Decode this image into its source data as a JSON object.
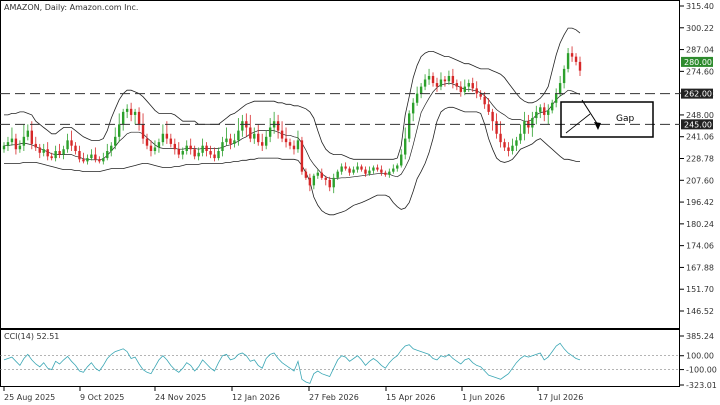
{
  "header": {
    "title": "AMAZON, Daily: Amazon.com Inc."
  },
  "cci": {
    "label": "CCI(14) 52.51"
  },
  "annotation": {
    "gap_label": "Gap"
  },
  "colors": {
    "up": "#2ca02c",
    "down": "#d62728",
    "cci": "#3ba7b5",
    "tag_green": "#2e8b2e",
    "tag_dark": "#222222"
  },
  "chart_data": {
    "type": "candlestick",
    "title": "AMAZON, Daily: Amazon.com Inc.",
    "price_axis": {
      "ticks": [
        "315.40",
        "300.22",
        "287.04",
        "274.60",
        "262.32",
        "248.00",
        "241.06",
        "228.78",
        "207.60",
        "196.42",
        "180.24",
        "174.06",
        "167.88",
        "151.70",
        "146.52"
      ],
      "tick_values": [
        315.4,
        300.22,
        287.04,
        274.6,
        262.32,
        248.0,
        241.06,
        228.78,
        207.6,
        196.42,
        180.24,
        174.06,
        167.88,
        151.7,
        146.52
      ]
    },
    "price_tags": [
      {
        "label": "280.00",
        "value": 280.0,
        "style": "green"
      },
      {
        "label": "262.00",
        "value": 262.0,
        "style": "dark"
      },
      {
        "label": "245.00",
        "value": 245.0,
        "style": "dark"
      }
    ],
    "horizontal_levels": [
      262.0,
      245.0
    ],
    "x_labels": [
      "25 Aug 2025",
      "9 Oct 2025",
      "24 Nov 2025",
      "12 Jan 2026",
      "27 Feb 2026",
      "15 Apr 2026",
      "1 Jun 2026",
      "17 Jul 2026"
    ],
    "close_series": [
      236,
      238,
      240,
      234,
      236,
      241,
      243,
      237,
      235,
      232,
      234,
      230,
      229,
      233,
      231,
      234,
      239,
      236,
      233,
      228,
      226,
      229,
      231,
      228,
      226,
      229,
      233,
      236,
      241,
      245,
      250,
      252,
      248,
      250,
      245,
      240,
      236,
      233,
      235,
      238,
      242,
      240,
      237,
      234,
      231,
      233,
      236,
      234,
      230,
      232,
      236,
      233,
      231,
      229,
      233,
      238,
      240,
      237,
      239,
      243,
      246,
      244,
      240,
      242,
      238,
      236,
      241,
      244,
      246,
      243,
      240,
      238,
      236,
      234,
      239,
      216,
      210,
      205,
      212,
      215,
      210,
      208,
      204,
      210,
      216,
      221,
      219,
      215,
      218,
      221,
      218,
      214,
      217,
      220,
      218,
      215,
      213,
      216,
      219,
      222,
      231,
      240,
      249,
      256,
      262,
      266,
      270,
      272,
      268,
      266,
      270,
      269,
      272,
      268,
      266,
      263,
      266,
      268,
      265,
      262,
      260,
      255,
      250,
      246,
      242,
      238,
      235,
      233,
      236,
      239,
      242,
      246,
      244,
      247,
      250,
      253,
      248,
      251,
      256,
      262,
      268,
      276,
      285,
      283,
      280,
      275
    ],
    "bb_upper": [
      248,
      248,
      249,
      249,
      250,
      250,
      249,
      248,
      246,
      245,
      244,
      243,
      242,
      242,
      243,
      244,
      244,
      244,
      243,
      242,
      241,
      240,
      239,
      239,
      239,
      240,
      243,
      247,
      252,
      258,
      262,
      264,
      264,
      263,
      262,
      260,
      257,
      254,
      251,
      249,
      249,
      249,
      249,
      248,
      247,
      246,
      246,
      246,
      246,
      245,
      245,
      245,
      245,
      245,
      245,
      246,
      247,
      248,
      249,
      251,
      253,
      255,
      256,
      257,
      257,
      257,
      257,
      257,
      257,
      256,
      256,
      255,
      255,
      254,
      254,
      253,
      252,
      250,
      247,
      243,
      238,
      234,
      232,
      231,
      231,
      231,
      230,
      229,
      228,
      228,
      228,
      228,
      228,
      228,
      228,
      228,
      228,
      228,
      228,
      229,
      236,
      248,
      260,
      271,
      278,
      283,
      285,
      286,
      286,
      285,
      284,
      283,
      283,
      282,
      281,
      280,
      279,
      279,
      278,
      277,
      276,
      276,
      276,
      275,
      274,
      273,
      271,
      268,
      265,
      262,
      259,
      257,
      256,
      256,
      257,
      259,
      262,
      266,
      275,
      284,
      291,
      296,
      300,
      300,
      299,
      297
    ],
    "bb_lower": [
      224,
      224,
      224,
      224,
      224,
      225,
      225,
      225,
      225,
      224,
      223,
      222,
      221,
      220,
      219,
      218,
      218,
      218,
      217,
      217,
      216,
      216,
      216,
      216,
      216,
      217,
      218,
      219,
      219,
      219,
      219,
      220,
      221,
      222,
      223,
      224,
      224,
      223,
      222,
      221,
      220,
      220,
      220,
      221,
      221,
      222,
      223,
      223,
      223,
      223,
      224,
      224,
      224,
      224,
      224,
      224,
      225,
      225,
      226,
      226,
      227,
      227,
      228,
      228,
      229,
      229,
      229,
      229,
      229,
      229,
      228,
      228,
      228,
      228,
      227,
      222,
      215,
      207,
      199,
      194,
      190,
      188,
      187,
      187,
      188,
      189,
      190,
      192,
      194,
      195,
      196,
      197,
      198,
      199,
      200,
      200,
      200,
      199,
      196,
      193,
      191,
      192,
      196,
      202,
      209,
      216,
      224,
      232,
      240,
      246,
      250,
      252,
      253,
      253,
      252,
      251,
      250,
      250,
      250,
      250,
      249,
      245,
      240,
      234,
      229,
      226,
      225,
      226,
      228,
      231,
      234,
      235,
      236,
      237,
      239,
      240,
      238,
      236,
      234,
      232,
      230,
      228,
      228,
      227,
      226,
      226
    ],
    "cci_axis": {
      "ticks": [
        "385.24",
        "100.00",
        "-100.00",
        "-323.01"
      ],
      "tick_values": [
        385.24,
        100.0,
        -100.0,
        -323.01
      ]
    },
    "cci_series": [
      40,
      60,
      80,
      20,
      -40,
      60,
      120,
      40,
      -20,
      -60,
      0,
      -80,
      -100,
      20,
      -20,
      40,
      90,
      20,
      -40,
      -120,
      -140,
      -60,
      0,
      -80,
      -120,
      -40,
      60,
      120,
      160,
      180,
      200,
      160,
      60,
      80,
      -20,
      -100,
      -140,
      -160,
      -60,
      40,
      100,
      40,
      -40,
      -100,
      -140,
      -80,
      0,
      -40,
      -120,
      -60,
      40,
      -20,
      -80,
      -120,
      0,
      100,
      120,
      40,
      60,
      120,
      140,
      100,
      20,
      40,
      -40,
      -80,
      60,
      120,
      140,
      60,
      0,
      -40,
      -80,
      -120,
      20,
      -240,
      -280,
      -300,
      -160,
      -120,
      -160,
      -180,
      -200,
      -80,
      40,
      100,
      80,
      20,
      60,
      100,
      40,
      -40,
      20,
      60,
      20,
      -40,
      -80,
      0,
      60,
      100,
      180,
      240,
      260,
      200,
      180,
      160,
      140,
      120,
      60,
      40,
      100,
      80,
      120,
      60,
      20,
      -20,
      40,
      60,
      0,
      -40,
      -60,
      -120,
      -180,
      -200,
      -220,
      -240,
      -200,
      -160,
      -80,
      0,
      60,
      100,
      80,
      100,
      120,
      140,
      40,
      80,
      160,
      240,
      280,
      200,
      140,
      100,
      60,
      40
    ]
  }
}
